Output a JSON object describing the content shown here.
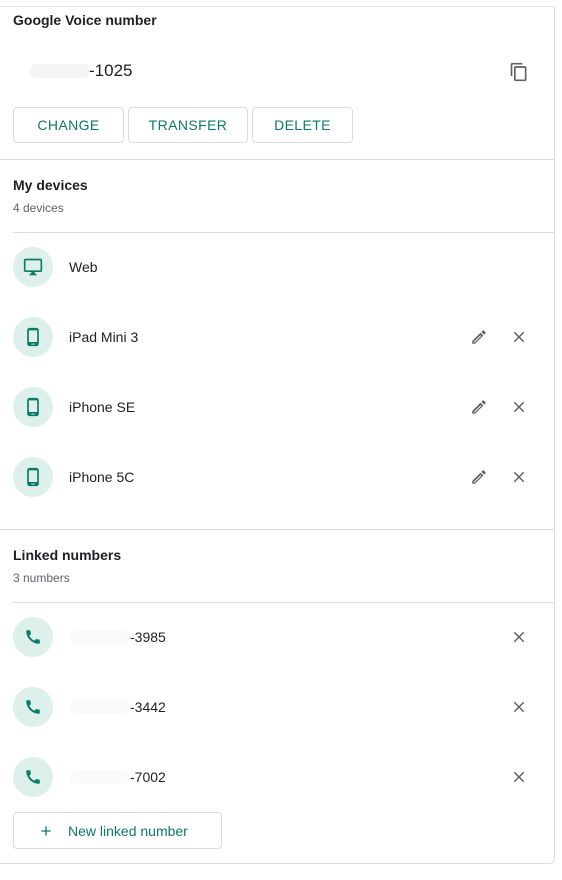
{
  "voice": {
    "title": "Google Voice number",
    "number": "-1025",
    "buttons": {
      "change": "CHANGE",
      "transfer": "TRANSFER",
      "delete": "DELETE"
    }
  },
  "devices": {
    "title": "My devices",
    "count": "4 devices",
    "items": [
      {
        "label": "Web",
        "icon": "monitor-icon"
      },
      {
        "label": "iPad Mini 3",
        "icon": "phone-icon"
      },
      {
        "label": "iPhone SE",
        "icon": "phone-icon"
      },
      {
        "label": "iPhone 5C",
        "icon": "phone-icon"
      }
    ]
  },
  "linked": {
    "title": "Linked numbers",
    "count": "3 numbers",
    "items": [
      {
        "number": "-3985",
        "icon": "call-icon"
      },
      {
        "number": "-3442",
        "icon": "call-icon"
      },
      {
        "number": "-7002",
        "icon": "call-icon"
      }
    ],
    "add_label": "New linked number"
  },
  "colors": {
    "accent": "#0b7a66",
    "avatar_bg": "#ddf0ec",
    "divider": "#dadce0"
  }
}
